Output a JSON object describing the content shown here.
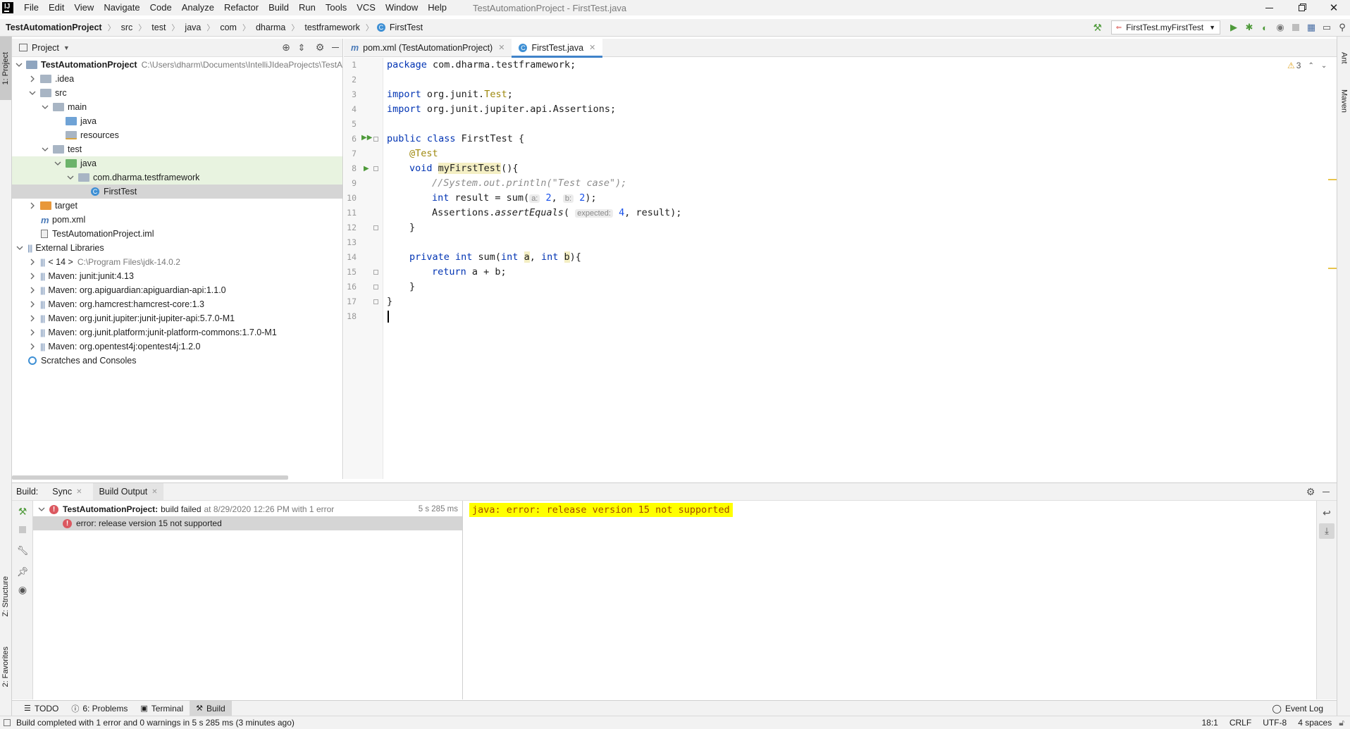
{
  "window": {
    "title": "TestAutomationProject - FirstTest.java",
    "menu": [
      "File",
      "Edit",
      "View",
      "Navigate",
      "Code",
      "Analyze",
      "Refactor",
      "Build",
      "Run",
      "Tools",
      "VCS",
      "Window",
      "Help"
    ]
  },
  "navbar": {
    "crumbs": [
      "TestAutomationProject",
      "src",
      "test",
      "java",
      "com",
      "dharma",
      "testframework",
      "FirstTest"
    ],
    "run_config": "FirstTest.myFirstTest"
  },
  "left_stripe": {
    "project": "1: Project",
    "structure": "Z: Structure",
    "favorites": "2: Favorites"
  },
  "right_stripe": {
    "ant": "Ant",
    "maven": "Maven"
  },
  "project_panel": {
    "title": "Project",
    "tree": [
      {
        "label": "TestAutomationProject",
        "path": "C:\\Users\\dharm\\Documents\\IntelliJIdeaProjects\\TestAu"
      },
      {
        "label": ".idea"
      },
      {
        "label": "src"
      },
      {
        "label": "main"
      },
      {
        "label": "java"
      },
      {
        "label": "resources"
      },
      {
        "label": "test"
      },
      {
        "label": "java"
      },
      {
        "label": "com.dharma.testframework"
      },
      {
        "label": "FirstTest"
      },
      {
        "label": "target"
      },
      {
        "label": "pom.xml"
      },
      {
        "label": "TestAutomationProject.iml"
      },
      {
        "label": "External Libraries"
      },
      {
        "label": "< 14 >",
        "path": "C:\\Program Files\\jdk-14.0.2"
      },
      {
        "label": "Maven: junit:junit:4.13"
      },
      {
        "label": "Maven: org.apiguardian:apiguardian-api:1.1.0"
      },
      {
        "label": "Maven: org.hamcrest:hamcrest-core:1.3"
      },
      {
        "label": "Maven: org.junit.jupiter:junit-jupiter-api:5.7.0-M1"
      },
      {
        "label": "Maven: org.junit.platform:junit-platform-commons:1.7.0-M1"
      },
      {
        "label": "Maven: org.opentest4j:opentest4j:1.2.0"
      },
      {
        "label": "Scratches and Consoles"
      }
    ]
  },
  "editor": {
    "tabs": [
      "pom.xml (TestAutomationProject)",
      "FirstTest.java"
    ],
    "active_tab": "FirstTest.java",
    "warning_count": "3",
    "line_numbers": [
      "1",
      "2",
      "3",
      "4",
      "5",
      "6",
      "7",
      "8",
      "9",
      "10",
      "11",
      "12",
      "13",
      "14",
      "15",
      "16",
      "17",
      "18"
    ],
    "code": {
      "l1_kw": "package",
      "l1_rest": " com.dharma.testframework;",
      "l3_kw": "import",
      "l3_pkg": " org.junit.",
      "l3_cls": "Test",
      "l3_end": ";",
      "l4_kw": "import",
      "l4_rest": " org.junit.jupiter.api.Assertions;",
      "l6_kw": "public class",
      "l6_rest": " FirstTest {",
      "l7_ann": "@Test",
      "l8_kw": "void",
      "l8_meth": "myFirstTest",
      "l8_rest": "(){",
      "l9_cmt": "//System.out.println(\"Test case\");",
      "l10_kw": "int",
      "l10_a": " result = sum(",
      "l10_h1": "a:",
      "l10_n1": "2",
      "l10_b": ", ",
      "l10_h2": "b:",
      "l10_n2": "2",
      "l10_end": ");",
      "l11_a": "Assertions.",
      "l11_meth": "assertEquals",
      "l11_b": "(",
      "l11_h": "expected:",
      "l11_n": "4",
      "l11_end": ", result);",
      "l12": "}",
      "l14_kw1": "private int",
      "l14_a": " sum(",
      "l14_kw2": "int",
      "l14_p1": "a",
      "l14_b": ", ",
      "l14_kw3": "int",
      "l14_p2": "b",
      "l14_end": "){",
      "l15_kw": "return",
      "l15_rest": " a + b;",
      "l16": "}",
      "l17": "}"
    }
  },
  "build": {
    "label": "Build:",
    "tabs": [
      "Sync",
      "Build Output"
    ],
    "root_title": "TestAutomationProject:",
    "root_status": "build failed",
    "root_detail": "at 8/29/2020 12:26 PM with 1 error",
    "root_time": "5 s 285 ms",
    "error_item": "error: release version 15 not supported",
    "output_line": "java: error: release version 15 not supported"
  },
  "tool_tabs": [
    "TODO",
    "6: Problems",
    "Terminal",
    "Build"
  ],
  "event_log": "Event Log",
  "status": {
    "message": "Build completed with 1 error and 0 warnings in 5 s 285 ms (3 minutes ago)",
    "position": "18:1",
    "line_sep": "CRLF",
    "encoding": "UTF-8",
    "indent": "4 spaces"
  },
  "colors": {
    "accent": "#4083c9",
    "error": "#db5860",
    "highlight": "#ffff00",
    "run_green": "#4e9a3a"
  }
}
